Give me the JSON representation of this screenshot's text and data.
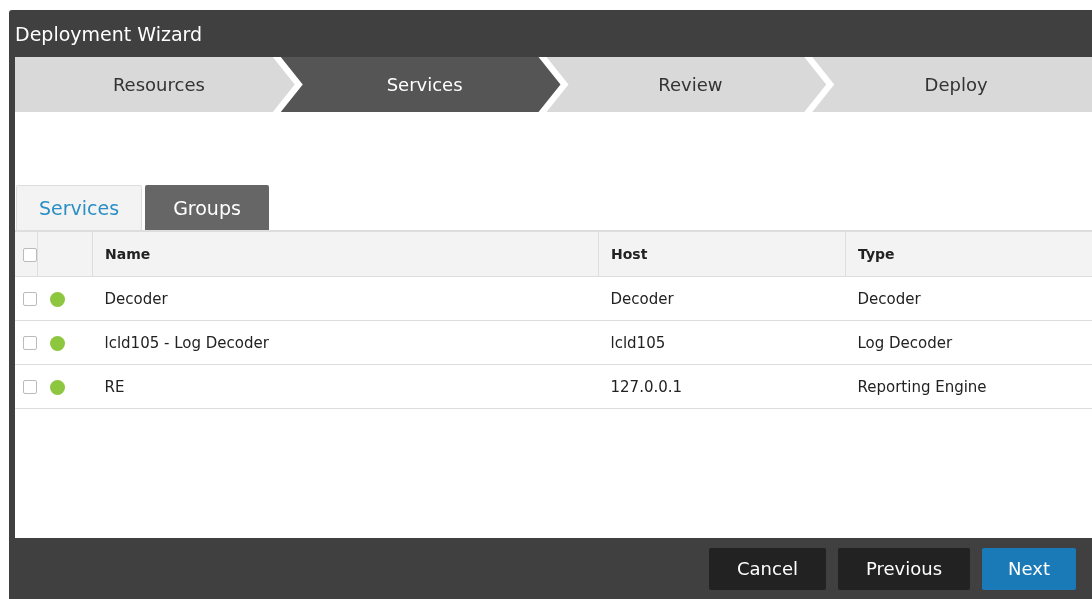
{
  "window": {
    "title": "Deployment Wizard"
  },
  "steps": [
    {
      "label": "Resources",
      "selected": false
    },
    {
      "label": "Services",
      "selected": true
    },
    {
      "label": "Review",
      "selected": false
    },
    {
      "label": "Deploy",
      "selected": false
    }
  ],
  "tabs": [
    {
      "label": "Services",
      "selected": true
    },
    {
      "label": "Groups",
      "selected": false
    }
  ],
  "table": {
    "header_checked": false,
    "columns": [
      "Name",
      "Host",
      "Type"
    ],
    "rows": [
      {
        "checked": false,
        "color": "#8dc63f",
        "cells": [
          "Decoder",
          "Decoder",
          "Decoder"
        ]
      },
      {
        "checked": false,
        "color": "#8dc63f",
        "cells": [
          "lcld105 - Log Decoder",
          "lcld105",
          "Log Decoder"
        ]
      },
      {
        "checked": false,
        "color": "#8dc63f",
        "cells": [
          "RE",
          "127.0.0.1",
          "Reporting Engine"
        ]
      }
    ]
  },
  "buttons": [
    {
      "label": "Cancel",
      "primary": false
    },
    {
      "label": "Previous",
      "primary": false
    },
    {
      "label": "Next",
      "primary": true
    }
  ]
}
